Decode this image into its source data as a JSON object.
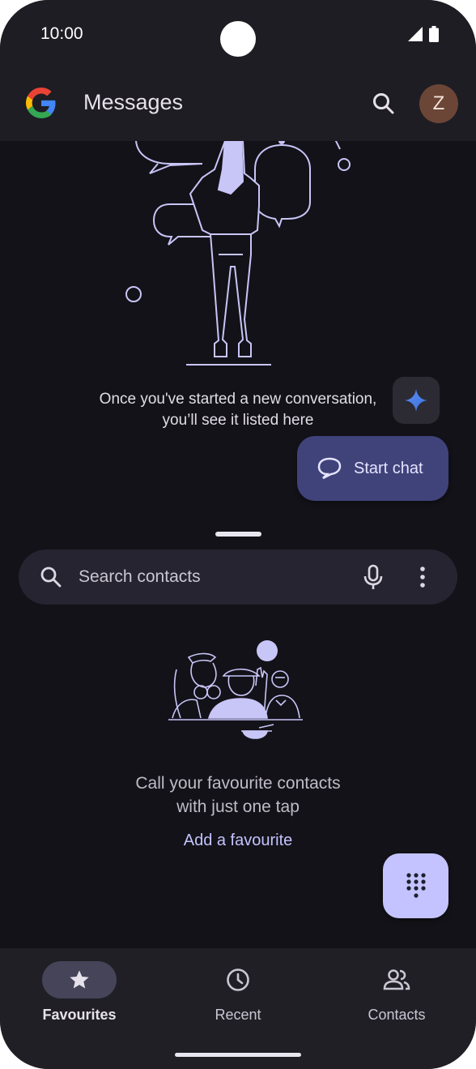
{
  "status_bar": {
    "time": "10:00"
  },
  "app_bar": {
    "title": "Messages",
    "avatar_letter": "Z"
  },
  "empty_state": {
    "line1": "Once you've started a new conversation,",
    "line2": "you’ll see it listed here"
  },
  "start_chat": {
    "label": "Start chat"
  },
  "contacts_search": {
    "placeholder": "Search contacts"
  },
  "favourites_empty": {
    "line1": "Call your favourite contacts",
    "line2": "with just one tap",
    "add_label": "Add a favourite"
  },
  "bottom_nav": {
    "items": [
      {
        "label": "Favourites",
        "icon": "star-icon",
        "active": true
      },
      {
        "label": "Recent",
        "icon": "clock-icon",
        "active": false
      },
      {
        "label": "Contacts",
        "icon": "contacts-icon",
        "active": false
      }
    ]
  },
  "colors": {
    "background": "#131218",
    "surface": "#1e1d24",
    "accent": "#c4c3ff",
    "start_chat_bg": "#3f437a",
    "avatar_bg": "#6b4536"
  }
}
